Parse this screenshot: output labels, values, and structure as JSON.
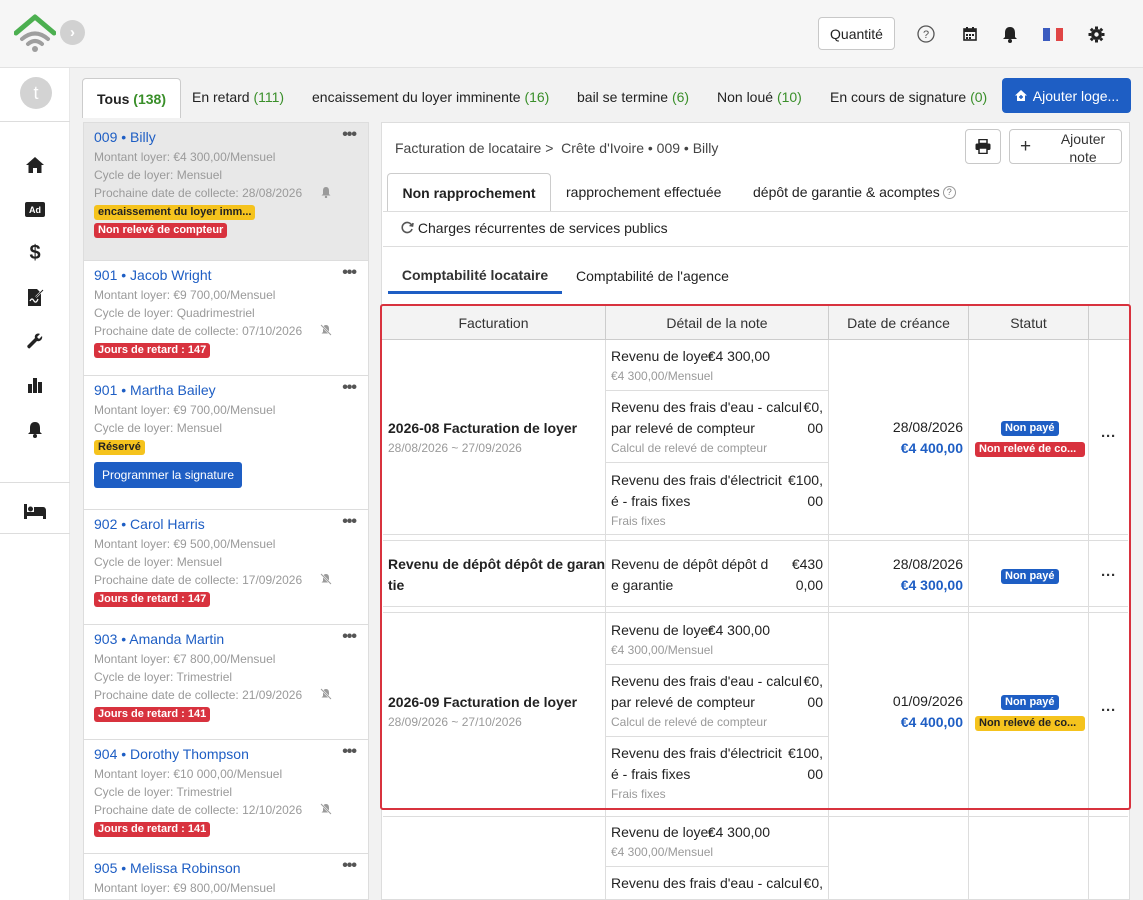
{
  "topbar": {
    "quantity_label": "Quantité"
  },
  "avatar_letter": "t",
  "tabs": [
    {
      "label": "Tous",
      "count": "(138)"
    },
    {
      "label": "En retard",
      "count": "(111)"
    },
    {
      "label": "encaissement du loyer imminente",
      "count": "(16)"
    },
    {
      "label": "bail se termine",
      "count": "(6)"
    },
    {
      "label": "Non loué",
      "count": "(10)"
    },
    {
      "label": "En cours de signature",
      "count": "(0)"
    }
  ],
  "add_button": "Ajouter loge...",
  "units": [
    {
      "unit": "009",
      "name": "Billy",
      "rent": "Montant loyer: €4 300,00/Mensuel",
      "cycle": "Cycle de loyer: Mensuel",
      "next": "Prochaine date de collecte:  28/08/2026",
      "badge1": "encaissement du loyer imm...",
      "badge2": "Non relevé de compteur"
    },
    {
      "unit": "901",
      "name": "Jacob Wright",
      "rent": "Montant loyer: €9 700,00/Mensuel",
      "cycle": "Cycle de loyer: Quadrimestriel",
      "next": "Prochaine date de collecte:  07/10/2026",
      "badge1": "Jours de retard : 147"
    },
    {
      "unit": "901",
      "name": "Martha Bailey",
      "rent": "Montant loyer: €9 700,00/Mensuel",
      "cycle": "Cycle de loyer: Mensuel",
      "badge1": "Réservé",
      "button": "Programmer la signature"
    },
    {
      "unit": "902",
      "name": "Carol Harris",
      "rent": "Montant loyer: €9 500,00/Mensuel",
      "cycle": "Cycle de loyer: Mensuel",
      "next": "Prochaine date de collecte:  17/09/2026",
      "badge1": "Jours de retard : 147"
    },
    {
      "unit": "903",
      "name": "Amanda Martin",
      "rent": "Montant loyer: €7 800,00/Mensuel",
      "cycle": "Cycle de loyer: Trimestriel",
      "next": "Prochaine date de collecte:  21/09/2026",
      "badge1": "Jours de retard : 141"
    },
    {
      "unit": "904",
      "name": "Dorothy Thompson",
      "rent": "Montant loyer: €10 000,00/Mensuel",
      "cycle": "Cycle de loyer: Trimestriel",
      "next": "Prochaine date de collecte:  12/10/2026",
      "badge1": "Jours de retard : 141"
    },
    {
      "unit": "905",
      "name": "Melissa Robinson",
      "rent": "Montant loyer: €9 800,00/Mensuel"
    }
  ],
  "breadcrumb": {
    "first": "Facturation de locataire >",
    "second": "Crête d'Ivoire • 009 • Billy"
  },
  "add_note": "Ajouter note",
  "detail_tabs": [
    "Non rapprochement",
    "rapprochement effectuée",
    "dépôt de garantie & acomptes"
  ],
  "charges_label": "Charges récurrentes de services publics",
  "acct_tabs": [
    "Comptabilité locataire",
    "Comptabilité de l'agence"
  ],
  "table": {
    "headers": [
      "Facturation",
      "Détail de la note",
      "Date de créance",
      "Statut"
    ],
    "rows": [
      {
        "title": "2026-08 Facturation de loyer",
        "period": "28/08/2026 ~ 27/09/2026",
        "d1": "Revenu de loyer",
        "d1a": "€4 300,00",
        "d1s": "€4 300,00/Mensuel",
        "d2l1": "Revenu des frais d'eau - calcul",
        "d2l2": "par relevé de compteur",
        "d2a1": "€0,",
        "d2a2": "00",
        "d2s": "Calcul de relevé de compteur",
        "d3l1": "Revenu des frais d'électricit",
        "d3l2": "é - frais fixes",
        "d3a1": "€100,",
        "d3a2": "00",
        "d3s": "Frais fixes",
        "date": "28/08/2026",
        "amount": "€4 400,00",
        "status": "Non payé",
        "status2": "Non relevé de co..."
      },
      {
        "title1": "Revenu de dépôt dépôt de garan",
        "title2": "tie",
        "d1l1": "Revenu de dépôt dépôt d",
        "d1l2": "e garantie",
        "d1a1": "€430",
        "d1a2": "0,00",
        "date": "28/08/2026",
        "amount": "€4 300,00",
        "status": "Non payé"
      },
      {
        "title": "2026-09 Facturation de loyer",
        "period": "28/09/2026 ~ 27/10/2026",
        "d1": "Revenu de loyer",
        "d1a": "€4 300,00",
        "d1s": "€4 300,00/Mensuel",
        "d2l1": "Revenu des frais d'eau - calcul",
        "d2l2": "par relevé de compteur",
        "d2a1": "€0,",
        "d2a2": "00",
        "d2s": "Calcul de relevé de compteur",
        "d3l1": "Revenu des frais d'électricit",
        "d3l2": "é - frais fixes",
        "d3a1": "€100,",
        "d3a2": "00",
        "d3s": "Frais fixes",
        "date": "01/09/2026",
        "amount": "€4 400,00",
        "status": "Non payé",
        "status2": "Non relevé de co..."
      },
      {
        "d1": "Revenu de loyer",
        "d1a": "€4 300,00",
        "d1s": "€4 300,00/Mensuel",
        "d2l1": "Revenu des frais d'eau - calcul",
        "d2a1": "€0,"
      }
    ]
  },
  "colors": {
    "accent": "#1e5ec4",
    "danger": "#d8323e",
    "warning": "#f5c31d",
    "count_green": "#3a8f2a"
  }
}
